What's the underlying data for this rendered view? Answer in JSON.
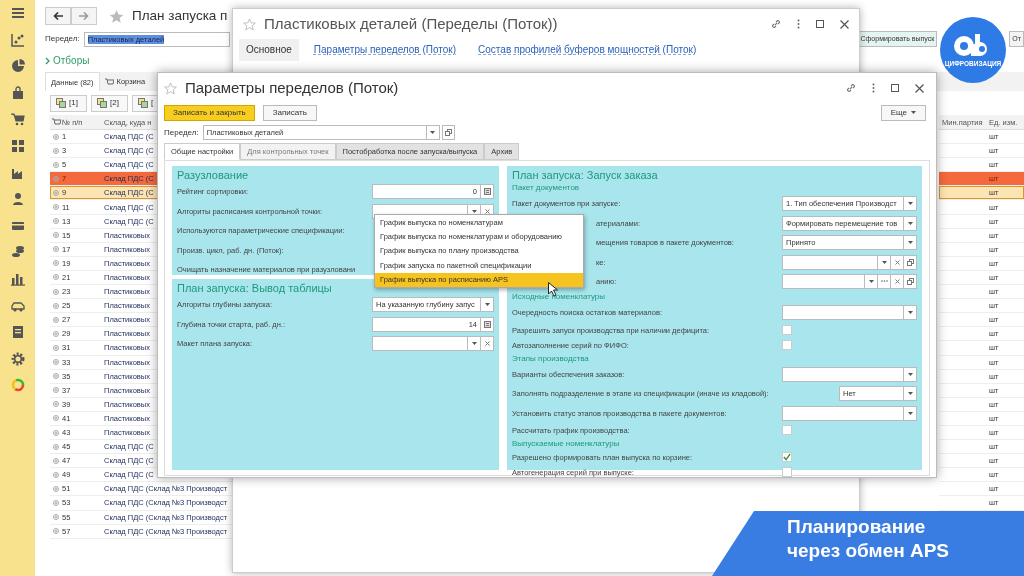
{
  "main_window": {
    "title": "План запуска п",
    "division_label": "Передел:",
    "division_value": "Пластиковых деталей",
    "action_button": "Сформировать выпуск",
    "other_button": "От",
    "filters_link": "Отборы",
    "tabs": [
      {
        "label": "Данные (82)",
        "selected": true
      },
      {
        "label": "Корзина",
        "selected": false
      }
    ],
    "toolbar_buttons": [
      "[1]",
      "[2]",
      "["
    ],
    "table": {
      "columns": [
        "№ п/п",
        "Склад, куда н",
        "Мин.партия",
        "Ед. изм."
      ],
      "rows": [
        {
          "number": "1",
          "warehouse": "Склад ПДС (С",
          "unit": "шт",
          "selected": false,
          "warning": false
        },
        {
          "number": "3",
          "warehouse": "Склад ПДС (С",
          "unit": "шт",
          "selected": false,
          "warning": false
        },
        {
          "number": "5",
          "warehouse": "Склад ПДС (С",
          "unit": "шт",
          "selected": false,
          "warning": false
        },
        {
          "number": "7",
          "warehouse": "Склад ПДС (С",
          "unit": "шт",
          "selected": false,
          "warning": true
        },
        {
          "number": "9",
          "warehouse": "Склад ПДС (С",
          "unit": "шт",
          "selected": true,
          "warning": false
        },
        {
          "number": "11",
          "warehouse": "Склад ПДС (С",
          "unit": "шт",
          "selected": false,
          "warning": false
        },
        {
          "number": "13",
          "warehouse": "Склад ПДС (С",
          "unit": "шт",
          "selected": false,
          "warning": false
        },
        {
          "number": "15",
          "warehouse": "Пластиковых",
          "unit": "шт",
          "selected": false,
          "warning": false
        },
        {
          "number": "17",
          "warehouse": "Пластиковых",
          "unit": "шт",
          "selected": false,
          "warning": false
        },
        {
          "number": "19",
          "warehouse": "Пластиковых",
          "unit": "шт",
          "selected": false,
          "warning": false
        },
        {
          "number": "21",
          "warehouse": "Пластиковых",
          "unit": "шт",
          "selected": false,
          "warning": false
        },
        {
          "number": "23",
          "warehouse": "Пластиковых",
          "unit": "шт",
          "selected": false,
          "warning": false
        },
        {
          "number": "25",
          "warehouse": "Пластиковых",
          "unit": "шт",
          "selected": false,
          "warning": false
        },
        {
          "number": "27",
          "warehouse": "Пластиковых",
          "unit": "шт",
          "selected": false,
          "warning": false
        },
        {
          "number": "29",
          "warehouse": "Пластиковых",
          "unit": "шт",
          "selected": false,
          "warning": false
        },
        {
          "number": "31",
          "warehouse": "Пластиковых",
          "unit": "шт",
          "selected": false,
          "warning": false
        },
        {
          "number": "33",
          "warehouse": "Пластиковых",
          "unit": "шт",
          "selected": false,
          "warning": false
        },
        {
          "number": "35",
          "warehouse": "Пластиковых",
          "unit": "шт",
          "selected": false,
          "warning": false
        },
        {
          "number": "37",
          "warehouse": "Пластиковых",
          "unit": "шт",
          "selected": false,
          "warning": false
        },
        {
          "number": "39",
          "warehouse": "Пластиковых",
          "unit": "шт",
          "selected": false,
          "warning": false
        },
        {
          "number": "41",
          "warehouse": "Пластиковых",
          "unit": "шт",
          "selected": false,
          "warning": false
        },
        {
          "number": "43",
          "warehouse": "Пластиковых",
          "unit": "шт",
          "selected": false,
          "warning": false
        },
        {
          "number": "45",
          "warehouse": "Склад ПДС (С",
          "unit": "шт",
          "selected": false,
          "warning": false
        },
        {
          "number": "47",
          "warehouse": "Склад ПДС (С",
          "unit": "шт",
          "selected": false,
          "warning": false
        },
        {
          "number": "49",
          "warehouse": "Склад ПДС (С",
          "unit": "шт",
          "selected": false,
          "warning": false
        },
        {
          "number": "51",
          "warehouse": "Склад ПДС (Склад №3 Производст",
          "unit": "шт",
          "selected": false,
          "warning": false
        },
        {
          "number": "53",
          "warehouse": "Склад ПДС (Склад №3 Производст",
          "unit": "шт",
          "selected": false,
          "warning": false
        },
        {
          "number": "55",
          "warehouse": "Склад ПДС (Склад №3 Производст",
          "selected": false,
          "warning": false
        },
        {
          "number": "57",
          "warehouse": "Склад ПДС (Склад №3 Производст",
          "selected": false,
          "warning": false
        }
      ]
    }
  },
  "top_window": {
    "title": "Пластиковых деталей (Переделы (Поток))",
    "tabs": [
      {
        "label": "Основное",
        "selected": true
      },
      {
        "label": "Параметры переделов (Поток)",
        "selected": false
      },
      {
        "label": "Состав профилей буферов мощностей (Поток)",
        "selected": false
      }
    ]
  },
  "dialog": {
    "title": "Параметры переделов (Поток)",
    "buttons": [
      {
        "label": "Записать и закрыть",
        "kind": "primary"
      },
      {
        "label": "Записать",
        "kind": "default"
      }
    ],
    "more_button": "Еще",
    "division_label": "Передел:",
    "division_value": "Пластиковых деталей",
    "tabs": [
      {
        "label": "Общие настройки",
        "selected": true,
        "disabled": false
      },
      {
        "label": "Для контрольных точек",
        "selected": false,
        "disabled": true
      },
      {
        "label": "Постобработка после запуска/выпуска",
        "selected": false,
        "disabled": false
      },
      {
        "label": "Архив",
        "selected": false,
        "disabled": false
      }
    ],
    "left_groups": [
      {
        "title": "Разузлование",
        "rows": [
          {
            "label": "Рейтинг сортировки:",
            "kind": "number",
            "value": "0"
          },
          {
            "label": "Алгориты расписания контрольной точки:",
            "kind": "select-clear"
          },
          {
            "label": "Используются параметрические спецификации:",
            "kind": "hidden"
          },
          {
            "label": "Произв. цикл, раб. дн. (Поток):",
            "kind": "hidden"
          },
          {
            "label": "Очищать назначение материалов при разузловани",
            "kind": "hidden"
          }
        ]
      },
      {
        "title": "План запуска: Вывод таблицы",
        "rows": [
          {
            "label": "Алгориты глубины запуска:",
            "kind": "select",
            "value": "На указанную глубину запус"
          },
          {
            "label": "Глубина точки старта, раб. дн.:",
            "kind": "number",
            "value": "14"
          },
          {
            "label": "Макет плана запуска:",
            "kind": "select-clear"
          }
        ]
      }
    ],
    "dropdown": {
      "items": [
        {
          "label": "График выпуска по номенклатурам",
          "selected": false
        },
        {
          "label": "График выпуска по номенклатурам и оборудованию",
          "selected": false
        },
        {
          "label": "График выпуска по плану производства",
          "selected": false
        },
        {
          "label": "График запуска по пакетной спецификации",
          "selected": false
        },
        {
          "label": "График выпуска по расписанию APS",
          "selected": true
        }
      ]
    },
    "right_group": {
      "title": "План запуска: Запуск заказа",
      "sections": [
        {
          "title": "Пакет документов",
          "rows": [
            {
              "label": "Пакет документов при запуске:",
              "kind": "select",
              "value": "1. Тип обеспечения Производст"
            },
            {
              "label": "атериалами:",
              "kind": "select",
              "value": "Формировать перемещение тов",
              "covered": true
            },
            {
              "label": "мещения товаров в пакете документов:",
              "kind": "select",
              "value": "Принято",
              "covered": true
            },
            {
              "label": "ке:",
              "kind": "select-clear-open",
              "covered": true
            },
            {
              "label": "анию:",
              "kind": "select-more-clear-open",
              "covered": true
            }
          ]
        },
        {
          "title": "Исходные номенклатуры",
          "rows": [
            {
              "label": "Очередность поиска остатков материалов:",
              "kind": "select"
            },
            {
              "label": "Разрешить запуск производства при наличии дефицита:",
              "kind": "checkbox",
              "checked": false
            },
            {
              "label": "Автозаполнение серий по ФИФО:",
              "kind": "checkbox",
              "checked": false
            }
          ]
        },
        {
          "title": "Этапы производства",
          "rows": [
            {
              "label": "Варианты обеспечения заказов:",
              "kind": "select"
            },
            {
              "label": "Заполнять подразделение в этапе из спецификации (иначе из кладовой):",
              "kind": "select-short",
              "value": "Нет"
            },
            {
              "label": "Установить статус этапов производства в пакете документов:",
              "kind": "select"
            },
            {
              "label": "Рассчитать график производства:",
              "kind": "checkbox",
              "checked": false
            }
          ]
        },
        {
          "title": "Выпускаемые номенклатуры",
          "rows": [
            {
              "label": "Разрешено формировать план выпуска по корзине:",
              "kind": "checkbox",
              "checked": true
            },
            {
              "label": "Автогенерация серий при выпуске:",
              "kind": "checkbox",
              "checked": false
            }
          ]
        }
      ]
    }
  },
  "logo": {
    "caption": "ЦИФРОВИЗАЦИЯ"
  },
  "banner": {
    "lines": [
      "Планирование",
      "через обмен APS"
    ]
  }
}
